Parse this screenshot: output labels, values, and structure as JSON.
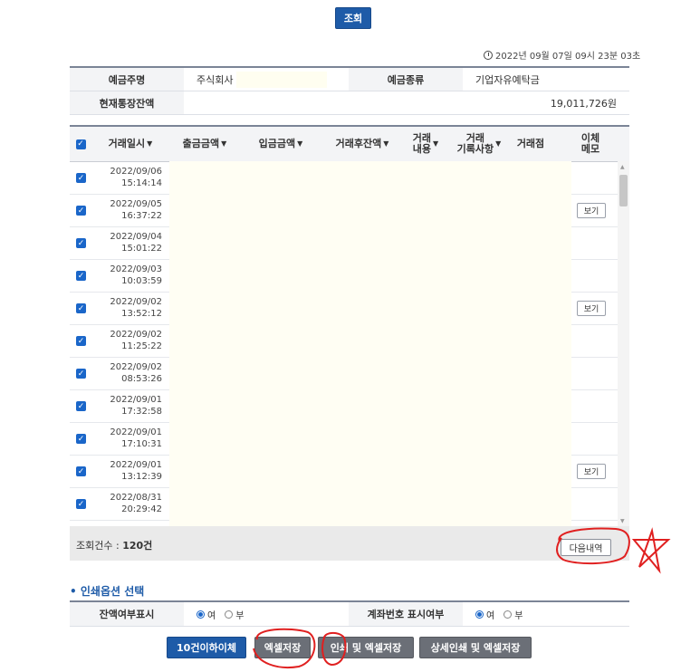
{
  "query_label": "조회",
  "timestamp": "2022년 09월 07일 09시 23분 03초",
  "info": {
    "owner_label": "예금주명",
    "owner_value": "주식회사",
    "type_label": "예금종류",
    "type_value": "기업자유예탁금",
    "balance_label": "현재통장잔액",
    "balance_value": "19,011,726원"
  },
  "headers": {
    "datetime": "거래일시",
    "withdraw": "출금금액",
    "deposit": "입금금액",
    "after_balance": "거래후잔액",
    "desc_1": "거래",
    "desc_2": "내용",
    "record_1": "거래",
    "record_2": "기록사항",
    "branch": "거래점",
    "memo_1": "이체",
    "memo_2": "메모"
  },
  "rows": [
    {
      "date": "2022/09/06",
      "time": "15:14:14",
      "memo": ""
    },
    {
      "date": "2022/09/05",
      "time": "16:37:22",
      "memo": "보기"
    },
    {
      "date": "2022/09/04",
      "time": "15:01:22",
      "memo": ""
    },
    {
      "date": "2022/09/03",
      "time": "10:03:59",
      "memo": ""
    },
    {
      "date": "2022/09/02",
      "time": "13:52:12",
      "memo": "보기"
    },
    {
      "date": "2022/09/02",
      "time": "11:25:22",
      "memo": ""
    },
    {
      "date": "2022/09/02",
      "time": "08:53:26",
      "memo": ""
    },
    {
      "date": "2022/09/01",
      "time": "17:32:58",
      "memo": ""
    },
    {
      "date": "2022/09/01",
      "time": "17:10:31",
      "memo": ""
    },
    {
      "date": "2022/09/01",
      "time": "13:12:39",
      "memo": "보기"
    },
    {
      "date": "2022/08/31",
      "time": "20:29:42",
      "memo": ""
    }
  ],
  "count_label": "조회건수 : ",
  "count_value": "120건",
  "next_label": "다음내역",
  "print_options_title": "인쇄옵션 선택",
  "options": {
    "balance_label": "잔액여부표시",
    "account_label": "계좌번호 표시여부",
    "yes": "여",
    "no": "부"
  },
  "buttons": {
    "transfer": "10건이하이체",
    "excel": "엑셀저장",
    "print_excel": "인쇄 및 엑셀저장",
    "detail_print_excel": "상세인쇄 및 엑셀저장"
  },
  "colors": {
    "primary": "#1e5ba8",
    "checkbox": "#1a66c9",
    "annotation": "#e02020"
  }
}
